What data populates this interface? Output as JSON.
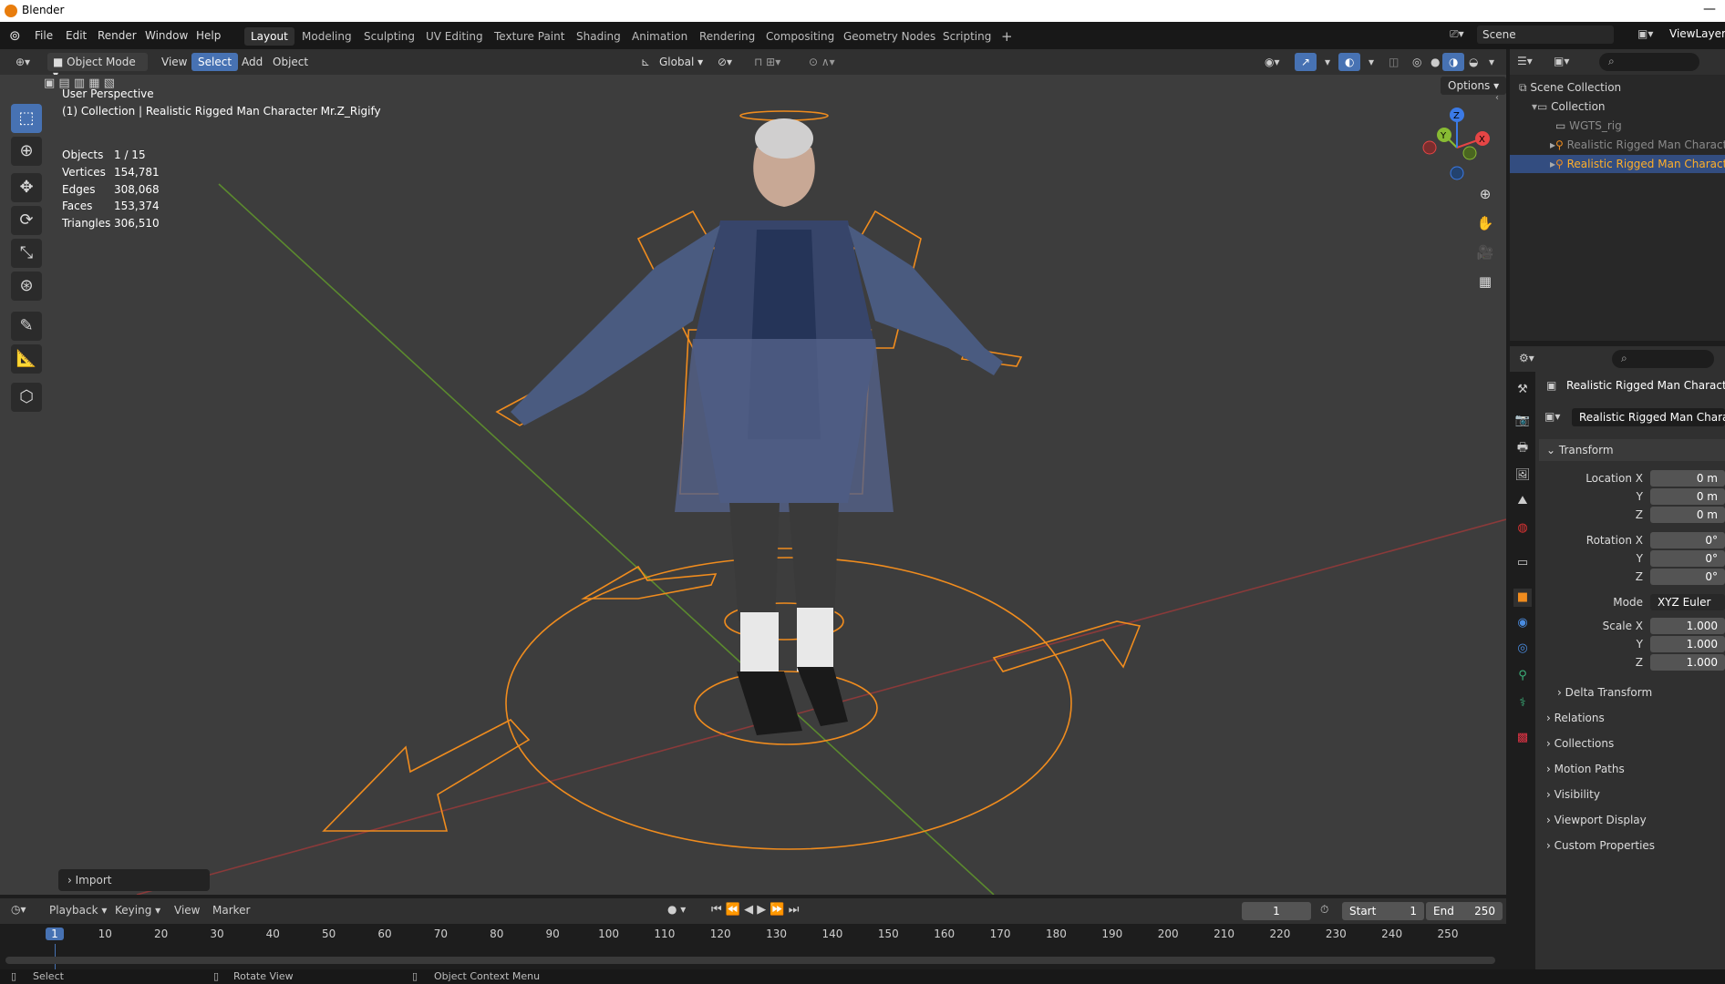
{
  "window": {
    "title": "Blender"
  },
  "menu": [
    "File",
    "Edit",
    "Render",
    "Window",
    "Help"
  ],
  "workspaces": [
    "Layout",
    "Modeling",
    "Sculpting",
    "UV Editing",
    "Texture Paint",
    "Shading",
    "Animation",
    "Rendering",
    "Compositing",
    "Geometry Nodes",
    "Scripting"
  ],
  "active_workspace": "Layout",
  "scene": {
    "label": "Scene",
    "view_layer": "ViewLayer"
  },
  "viewport_header": {
    "mode": "Object Mode",
    "menus": [
      "View",
      "Select",
      "Add",
      "Object"
    ],
    "selected_menu": "Select",
    "orientation": "Global",
    "options": "Options"
  },
  "viewport": {
    "perspective": "User Perspective",
    "collection_line": "(1) Collection | Realistic Rigged Man Character Mr.Z_Rigify",
    "stats": [
      {
        "label": "Objects",
        "value": "1 / 15"
      },
      {
        "label": "Vertices",
        "value": "154,781"
      },
      {
        "label": "Edges",
        "value": "308,068"
      },
      {
        "label": "Faces",
        "value": "153,374"
      },
      {
        "label": "Triangles",
        "value": "306,510"
      }
    ],
    "import_panel": "Import",
    "gizmo_axes": [
      "X",
      "Y",
      "Z"
    ]
  },
  "tools": [
    "select-box-tool",
    "cursor-tool",
    "move-tool",
    "rotate-tool",
    "scale-tool",
    "transform-tool",
    "annotate-tool",
    "measure-tool",
    "add-cube-tool"
  ],
  "outliner": {
    "rows": [
      {
        "label": "Scene Collection",
        "indent": 0,
        "selected": false,
        "dim": false
      },
      {
        "label": "Collection",
        "indent": 1,
        "selected": false,
        "dim": false
      },
      {
        "label": "WGTS_rig",
        "indent": 2,
        "selected": false,
        "dim": true
      },
      {
        "label": "Realistic Rigged Man Character",
        "indent": 2,
        "selected": false,
        "dim": true
      },
      {
        "label": "Realistic Rigged Man Character",
        "indent": 2,
        "selected": true,
        "dim": false
      }
    ]
  },
  "properties": {
    "object_name": "Realistic Rigged Man Character M",
    "data_name": "Realistic Rigged Man Characte",
    "transform_title": "Transform",
    "location": [
      {
        "label": "Location X",
        "value": "0 m"
      },
      {
        "label": "Y",
        "value": "0 m"
      },
      {
        "label": "Z",
        "value": "0 m"
      }
    ],
    "rotation": [
      {
        "label": "Rotation X",
        "value": "0°"
      },
      {
        "label": "Y",
        "value": "0°"
      },
      {
        "label": "Z",
        "value": "0°"
      }
    ],
    "mode_label": "Mode",
    "mode_value": "XYZ Euler",
    "scale": [
      {
        "label": "Scale X",
        "value": "1.000"
      },
      {
        "label": "Y",
        "value": "1.000"
      },
      {
        "label": "Z",
        "value": "1.000"
      }
    ],
    "delta_transform": "Delta Transform",
    "sections": [
      "Relations",
      "Collections",
      "Motion Paths",
      "Visibility",
      "Viewport Display",
      "Custom Properties"
    ]
  },
  "timeline": {
    "menus": [
      "Playback",
      "Keying",
      "View",
      "Marker"
    ],
    "current_frame": "1",
    "start_label": "Start",
    "start": "1",
    "end_label": "End",
    "end": "250",
    "ruler": [
      "1",
      "10",
      "20",
      "30",
      "40",
      "50",
      "60",
      "70",
      "80",
      "90",
      "100",
      "110",
      "120",
      "130",
      "140",
      "150",
      "160",
      "170",
      "180",
      "190",
      "200",
      "210",
      "220",
      "230",
      "240",
      "250"
    ]
  },
  "statusbar": [
    "Select",
    "Rotate View",
    "Object Context Menu"
  ],
  "colors": {
    "accent": "#4772b3",
    "selection_orange": "#ffaf29",
    "rig_orange": "#f08c1e",
    "x_axis": "#e64545",
    "y_axis": "#88bb33",
    "z_axis": "#3b7ae6"
  }
}
